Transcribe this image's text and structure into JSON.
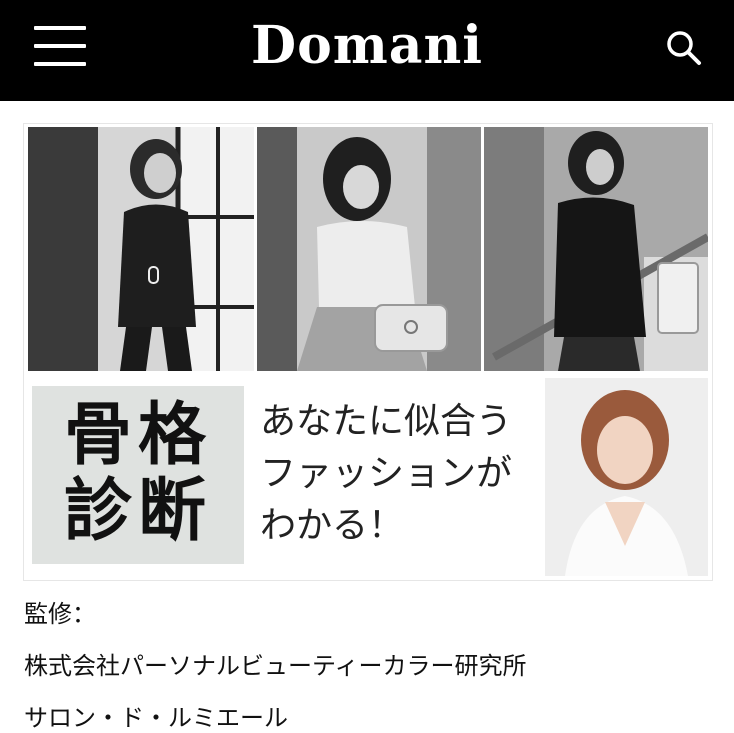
{
  "header": {
    "logo": "Domani",
    "menu_icon": "hamburger-menu-icon",
    "search_icon": "search-icon",
    "background": "#000000"
  },
  "banner": {
    "title_line1": "骨格",
    "title_line2": "診断",
    "tagline_line1": "あなたに似合う",
    "tagline_line2": "ファッションが",
    "tagline_line3": "わかる！"
  },
  "credits": {
    "label": "監修：",
    "company": "株式会社パーソナルビューティーカラー研究所",
    "salon": "サロン・ド・ルミエール"
  }
}
